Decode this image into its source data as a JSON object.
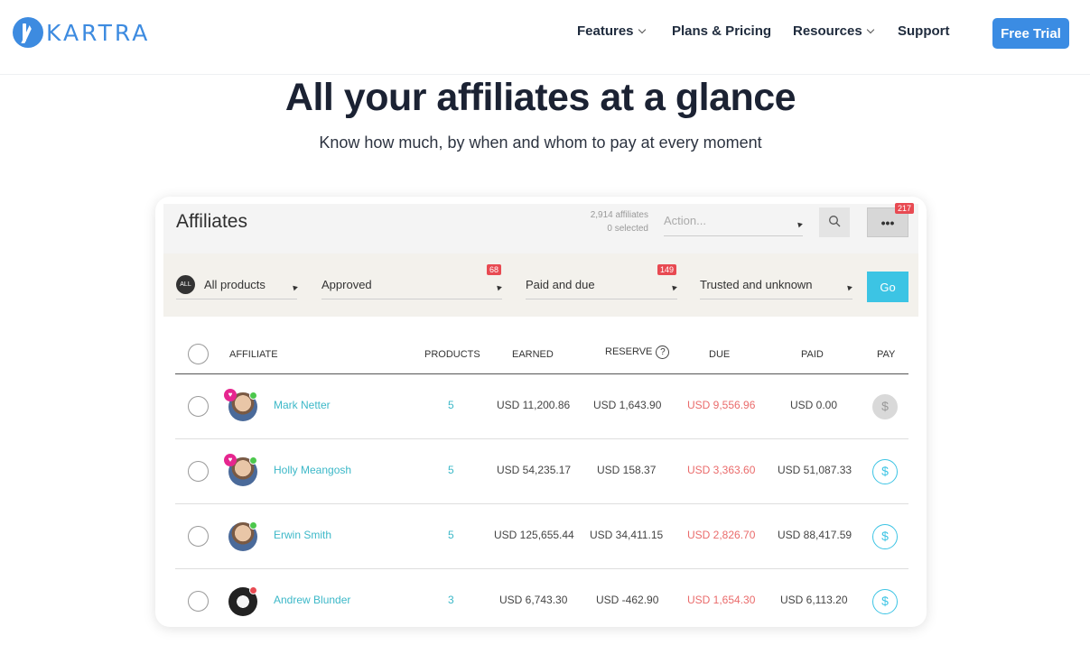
{
  "header": {
    "brand": "KARTRA",
    "nav": [
      {
        "label": "Features",
        "dropdown": true
      },
      {
        "label": "Plans & Pricing",
        "dropdown": false
      },
      {
        "label": "Resources",
        "dropdown": true
      },
      {
        "label": "Support",
        "dropdown": false
      }
    ],
    "cta": "Free Trial"
  },
  "hero": {
    "title": "All your affiliates at a glance",
    "subtitle": "Know how much, by when and whom to pay at every moment"
  },
  "panel": {
    "title": "Affiliates",
    "count_line1": "2,914 affiliates",
    "count_line2": "0 selected",
    "action_placeholder": "Action...",
    "more_label": "•••",
    "more_badge": "217",
    "filters": {
      "all_badge": "ALL",
      "products": "All products",
      "status": "Approved",
      "status_badge": "68",
      "payments": "Paid and due",
      "payments_badge": "149",
      "trust": "Trusted and unknown",
      "go": "Go"
    },
    "columns": [
      "AFFILIATE",
      "PRODUCTS",
      "EARNED",
      "RESERVE",
      "DUE",
      "PAID",
      "PAY"
    ],
    "rows": [
      {
        "name": "Mark Netter",
        "products": "5",
        "earned": "USD 11,200.86",
        "reserve": "USD 1,643.90",
        "due": "USD 9,556.96",
        "paid": "USD 0.00",
        "pay_enabled": false,
        "status_color": "#4cc74c",
        "heart": true
      },
      {
        "name": "Holly Meangosh",
        "products": "5",
        "earned": "USD 54,235.17",
        "reserve": "USD 158.37",
        "due": "USD 3,363.60",
        "paid": "USD 51,087.33",
        "pay_enabled": true,
        "status_color": "#4cc74c",
        "heart": true
      },
      {
        "name": "Erwin Smith",
        "products": "5",
        "earned": "USD 125,655.44",
        "reserve": "USD 34,411.15",
        "due": "USD 2,826.70",
        "paid": "USD 88,417.59",
        "pay_enabled": true,
        "status_color": "#4cc74c",
        "heart": false
      },
      {
        "name": "Andrew Blunder",
        "products": "3",
        "earned": "USD 6,743.30",
        "reserve": "USD -462.90",
        "due": "USD 1,654.30",
        "paid": "USD 6,113.20",
        "pay_enabled": true,
        "status_color": "#e84a52",
        "heart": false
      }
    ],
    "pay_symbol": "$"
  }
}
